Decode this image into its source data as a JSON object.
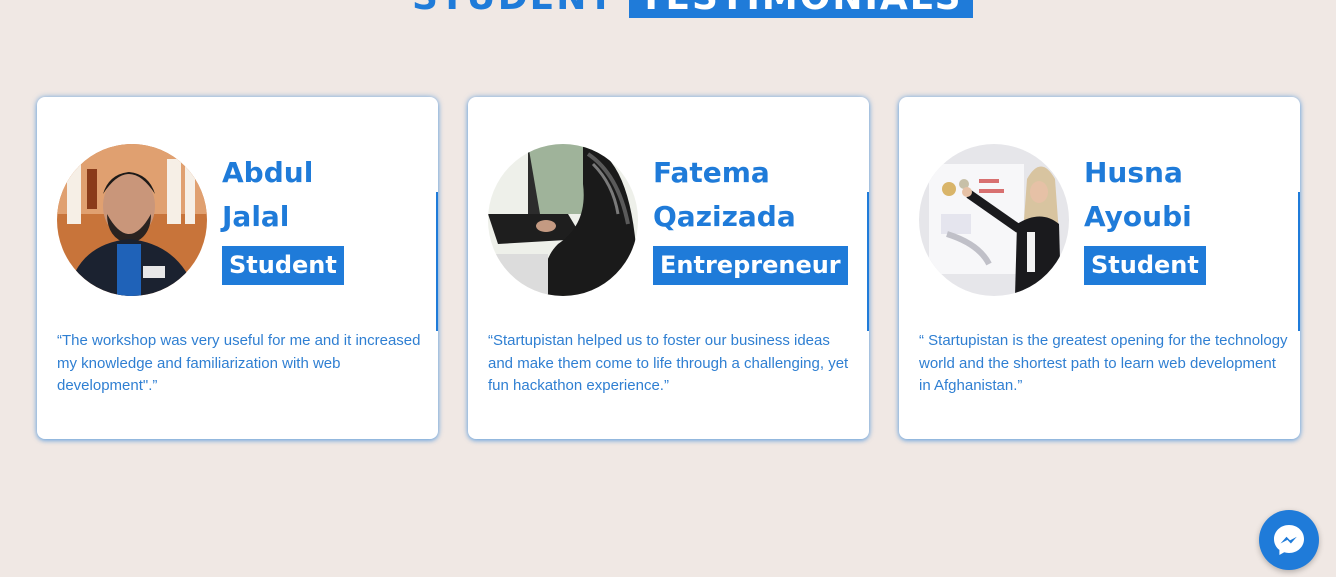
{
  "section": {
    "title_part1": "STUDENT",
    "title_part2": "TESTIMONIALS"
  },
  "colors": {
    "accent": "#1f7bd9",
    "background": "#f0e8e4",
    "card": "#ffffff"
  },
  "testimonials": [
    {
      "first_name": "Abdul",
      "last_name": "Jalal",
      "role": "Student",
      "quote": "“The workshop was very useful for me and it increased my knowledge and familiarization with web development\".”",
      "photo": "young man in dark jacket"
    },
    {
      "first_name": "Fatema",
      "last_name": "Qazizada",
      "role": "Entrepreneur",
      "quote": "“Startupistan helped us to foster our business ideas and make them come to life through a challenging, yet fun hackathon experience.”",
      "photo": "person typing on laptop"
    },
    {
      "first_name": "Husna",
      "last_name": "Ayoubi",
      "role": "Student",
      "quote": "“ Startupistan is the greatest opening for the technology world and the shortest path to learn web development in Afghanistan.”",
      "photo": "woman presenting at whiteboard"
    }
  ],
  "chat_widget": {
    "icon": "messenger-icon"
  }
}
